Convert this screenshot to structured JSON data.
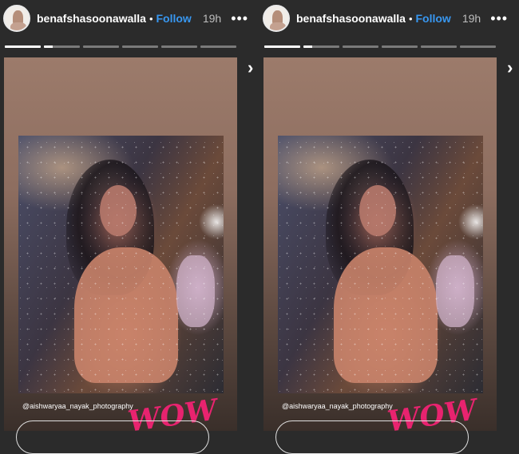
{
  "panels": [
    {
      "username": "benafshasoonawalla",
      "separator": "•",
      "follow_label": "Follow",
      "time": "19h",
      "more": "•••",
      "progress": [
        1.0,
        0.25,
        0,
        0,
        0,
        0
      ],
      "photo_credit": "@aishwaryaa_nayak_photography",
      "sticker_text": "WOW",
      "next_icon": "›"
    },
    {
      "username": "benafshasoonawalla",
      "separator": "•",
      "follow_label": "Follow",
      "time": "19h",
      "more": "•••",
      "progress": [
        1.0,
        0.25,
        0,
        0,
        0,
        0
      ],
      "photo_credit": "@aishwaryaa_nayak_photography",
      "sticker_text": "WOW",
      "next_icon": "›"
    }
  ],
  "colors": {
    "background": "#2b2b2b",
    "follow": "#3897f0",
    "sticker": "#e8236f"
  }
}
